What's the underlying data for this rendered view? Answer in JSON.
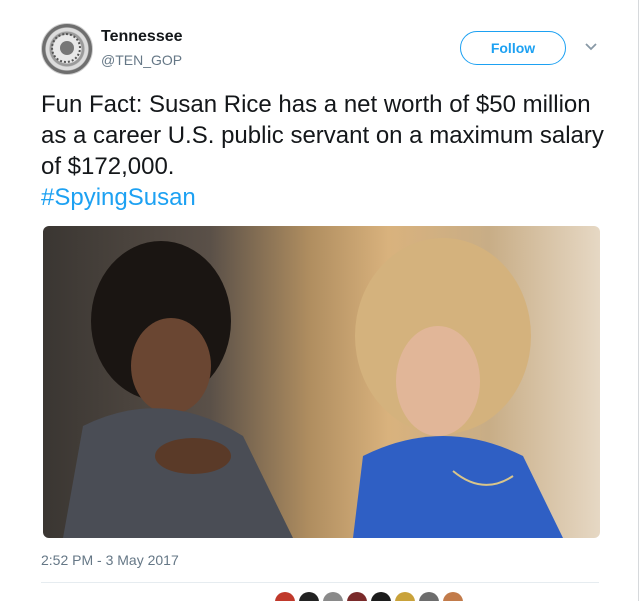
{
  "account": {
    "name": "Tennessee",
    "handle": "@TEN_GOP"
  },
  "follow_button": {
    "label": "Follow"
  },
  "more_icon": "chevron-down-icon",
  "tweet": {
    "text": "Fun Fact: Susan Rice has a net worth of $50 million as a career U.S. public servant on a maximum salary of $172,000.",
    "hashtag": "#SpyingSusan"
  },
  "timestamp": "2:52 PM - 3 May 2017",
  "colors": {
    "accent": "#1da1f2",
    "secondary_text": "#657786",
    "divider": "#e6ecf0"
  },
  "likers": [
    {
      "color": "#c0392b"
    },
    {
      "color": "#222222"
    },
    {
      "color": "#8a8a8a"
    },
    {
      "color": "#7a2a2a"
    },
    {
      "color": "#1c1c1c"
    },
    {
      "color": "#c9a23a"
    },
    {
      "color": "#6d6d6d"
    },
    {
      "color": "#c27b4a"
    }
  ]
}
